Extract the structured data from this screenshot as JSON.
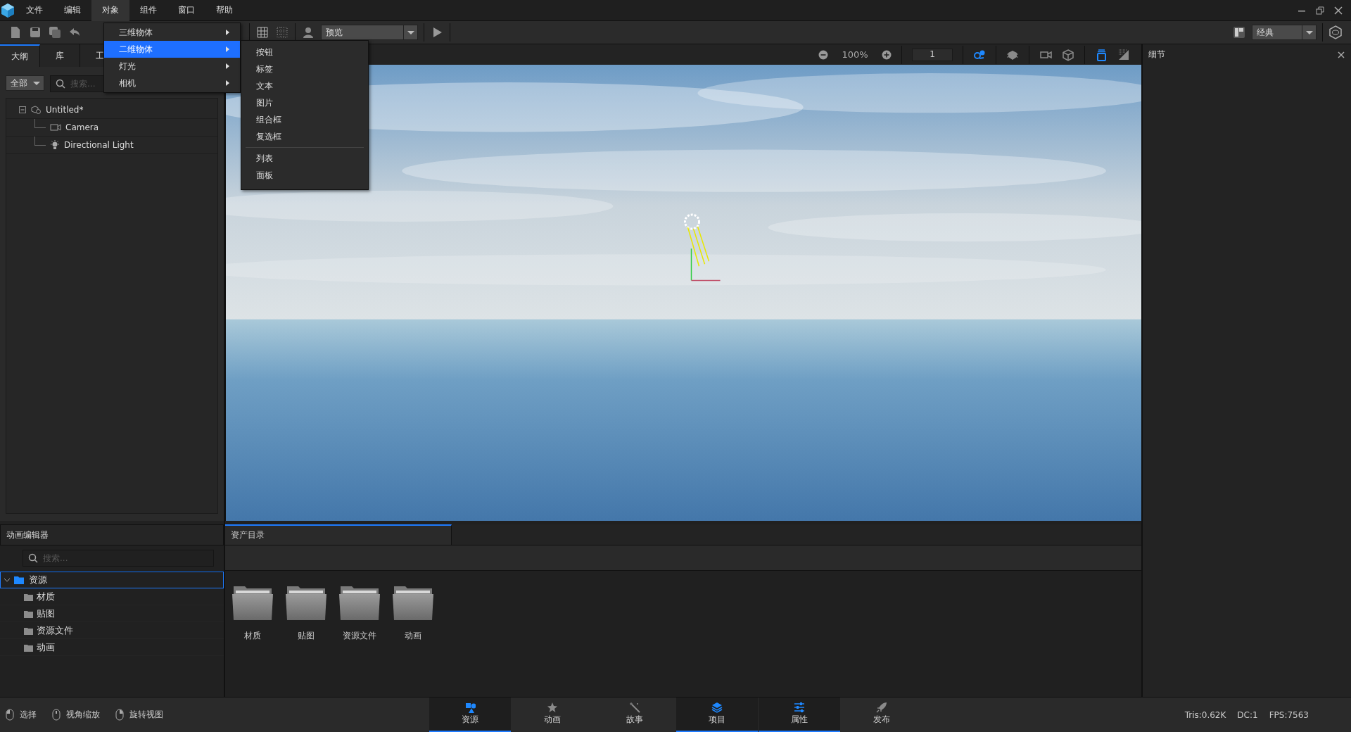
{
  "menu_bar": {
    "items": [
      {
        "label": "文件",
        "selected": false
      },
      {
        "label": "编辑",
        "selected": false
      },
      {
        "label": "对象",
        "selected": true
      },
      {
        "label": "组件",
        "selected": false
      },
      {
        "label": "窗口",
        "selected": false
      },
      {
        "label": "帮助",
        "selected": false
      }
    ]
  },
  "toolbar": {
    "preview_select": "预览",
    "layout_select": "经典"
  },
  "object_menu": {
    "items": [
      {
        "label": "三维物体",
        "selected": false
      },
      {
        "label": "二维物体",
        "selected": true
      },
      {
        "label": "灯光",
        "selected": false
      },
      {
        "label": "相机",
        "selected": false
      }
    ]
  },
  "submenu": {
    "groups": [
      [
        "按钮",
        "标签",
        "文本",
        "图片",
        "组合框",
        "复选框"
      ],
      [
        "列表",
        "面板"
      ]
    ]
  },
  "outline": {
    "tabs": [
      {
        "label": "大纲",
        "selected": true
      },
      {
        "label": "库",
        "selected": false
      },
      {
        "label": "工",
        "selected": false
      }
    ],
    "filter": "全部",
    "search": {
      "placeholder": "搜索..."
    },
    "tree": [
      {
        "label": "Untitled*",
        "kind": "scene",
        "expanded": true,
        "children": [
          {
            "label": "Camera",
            "kind": "camera"
          },
          {
            "label": "Directional Light",
            "kind": "light"
          }
        ]
      }
    ]
  },
  "viewport": {
    "zoom": "100%",
    "frame": "1",
    "tools": [
      {
        "kind": "snap",
        "selected": true
      },
      {
        "kind": "render",
        "selected": false
      },
      {
        "kind": "camera",
        "selected": false
      },
      {
        "kind": "cube",
        "selected": false
      },
      {
        "kind": "layers",
        "selected": true
      },
      {
        "kind": "shading",
        "selected": false
      }
    ]
  },
  "details": {
    "title": "细节"
  },
  "animation_editor": {
    "title": "动画编辑器",
    "search": {
      "placeholder": "搜索..."
    },
    "tree": [
      {
        "label": "资源",
        "expanded": true,
        "selected": true,
        "children": [
          {
            "label": "材质",
            "selected": false
          },
          {
            "label": "贴图",
            "selected": false
          },
          {
            "label": "资源文件",
            "selected": false
          },
          {
            "label": "动画",
            "selected": false
          }
        ]
      }
    ]
  },
  "asset_browser": {
    "tabs": [
      {
        "label": "资产目录",
        "selected": true
      }
    ],
    "folders": [
      "材质",
      "贴图",
      "资源文件",
      "动画"
    ]
  },
  "status_bar": {
    "mouse_hints": [
      {
        "label": "选择",
        "kind": "left"
      },
      {
        "label": "视角缩放",
        "kind": "middle"
      },
      {
        "label": "旋转视图",
        "kind": "right"
      }
    ],
    "panels": [
      {
        "label": "资源",
        "kind": "assets",
        "selected": true
      },
      {
        "label": "动画",
        "kind": "animation",
        "selected": false
      },
      {
        "label": "故事",
        "kind": "story",
        "selected": false
      },
      {
        "label": "项目",
        "kind": "project",
        "selected": true
      },
      {
        "label": "属性",
        "kind": "properties",
        "selected": true
      },
      {
        "label": "发布",
        "kind": "publish",
        "selected": false
      }
    ],
    "stats": [
      "Tris:0.62K",
      "DC:1",
      "FPS:7563"
    ]
  }
}
